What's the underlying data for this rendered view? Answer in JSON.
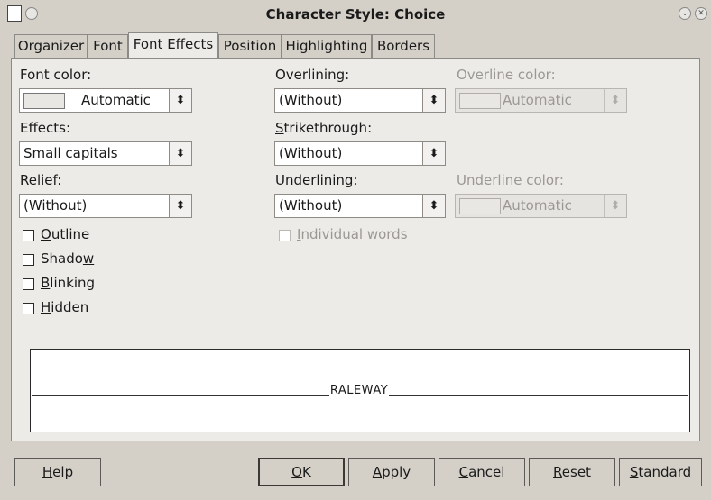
{
  "window": {
    "title": "Character Style: Choice"
  },
  "tabs": [
    {
      "label": "Organizer"
    },
    {
      "label": "Font"
    },
    {
      "label": "Font Effects",
      "active": true
    },
    {
      "label": "Position"
    },
    {
      "label": "Highlighting"
    },
    {
      "label": "Borders"
    }
  ],
  "font_color": {
    "label": "Font color:",
    "value": "Automatic"
  },
  "effects": {
    "label": "Effects:",
    "value": "Small capitals"
  },
  "relief": {
    "label": "Relief:",
    "value": "(Without)"
  },
  "overlining": {
    "label": "Overlining:",
    "value": "(Without)"
  },
  "strikethrough": {
    "label_first": "S",
    "label_rest": "trikethrough:",
    "value": "(Without)"
  },
  "underlining": {
    "label": "Underlining:",
    "value": "(Without)"
  },
  "overline_color": {
    "label": "Overline color:",
    "value": "Automatic"
  },
  "underline_color": {
    "label_first": "U",
    "label_rest": "nderline color:",
    "value": "Automatic"
  },
  "checkboxes": {
    "outline": {
      "pre": "",
      "u": "O",
      "post": "utline"
    },
    "shadow": {
      "pre": "Shado",
      "u": "w",
      "post": ""
    },
    "blinking": {
      "pre": "",
      "u": "B",
      "post": "linking"
    },
    "hidden": {
      "pre": "",
      "u": "H",
      "post": "idden"
    },
    "individual_words": {
      "pre": "",
      "u": "I",
      "post": "ndividual words"
    }
  },
  "preview": {
    "text": "RALEWAY"
  },
  "buttons": {
    "help": {
      "pre": "",
      "u": "H",
      "post": "elp"
    },
    "ok": {
      "pre": "",
      "u": "O",
      "post": "K"
    },
    "apply": {
      "pre": "",
      "u": "A",
      "post": "pply"
    },
    "cancel": {
      "pre": "",
      "u": "C",
      "post": "ancel"
    },
    "reset": {
      "pre": "",
      "u": "R",
      "post": "eset"
    },
    "standard": {
      "pre": "",
      "u": "S",
      "post": "tandard"
    }
  }
}
